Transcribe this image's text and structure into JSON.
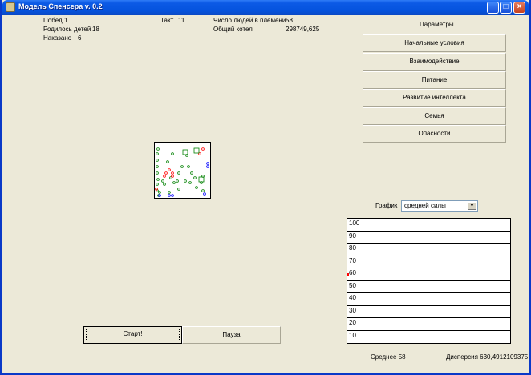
{
  "window": {
    "title": "Модель Спенсера v. 0.2"
  },
  "stats": {
    "wins_label": "Побед",
    "wins": "1",
    "births_label": "Родилось детей",
    "births": "18",
    "punished_label": "Наказано",
    "punished": "6",
    "tick_label": "Такт",
    "tick": "11",
    "people_label": "Число людей в племени",
    "people": "58",
    "pot_label": "Общий котел",
    "pot": "298749,625"
  },
  "params": {
    "title": "Параметры",
    "buttons": [
      "Начальные условия",
      "Взаимодействие",
      "Питание",
      "Развитие интеллекта",
      "Семья",
      "Опасности"
    ]
  },
  "graph": {
    "label": "График",
    "selected": "средней силы",
    "rows": [
      "100",
      "90",
      "80",
      "70",
      "60",
      "50",
      "40",
      "30",
      "20",
      "10"
    ],
    "mean_label": "Среднее",
    "mean": "58",
    "disp_label": "Дисперсия",
    "disp": "630,4912109375"
  },
  "controls": {
    "start": "Старт!",
    "pause": "Пауза"
  },
  "colors": {
    "green": "#008000",
    "red": "#ff0000",
    "blue": "#0000ff",
    "title_bar": "#0553dd"
  },
  "field_agents": {
    "green": [
      [
        4,
        8
      ],
      [
        3,
        14
      ],
      [
        3,
        22
      ],
      [
        3,
        30
      ],
      [
        3,
        38
      ],
      [
        4,
        46
      ],
      [
        3,
        52
      ],
      [
        3,
        60
      ],
      [
        5,
        66
      ],
      [
        22,
        14
      ],
      [
        20,
        44
      ],
      [
        24,
        50
      ],
      [
        30,
        58
      ],
      [
        38,
        48
      ],
      [
        44,
        50
      ],
      [
        46,
        38
      ],
      [
        50,
        44
      ],
      [
        52,
        56
      ],
      [
        58,
        50
      ],
      [
        60,
        60
      ],
      [
        60,
        42
      ],
      [
        42,
        30
      ],
      [
        40,
        16
      ],
      [
        12,
        52
      ],
      [
        16,
        24
      ],
      [
        6,
        62
      ],
      [
        10,
        48
      ],
      [
        18,
        62
      ],
      [
        28,
        48
      ],
      [
        34,
        30
      ],
      [
        30,
        38
      ]
    ],
    "red": [
      [
        14,
        38
      ],
      [
        18,
        34
      ],
      [
        22,
        38
      ],
      [
        22,
        42
      ],
      [
        60,
        8
      ],
      [
        56,
        14
      ],
      [
        2,
        58
      ],
      [
        12,
        42
      ]
    ],
    "blue": [
      [
        66,
        26
      ],
      [
        66,
        30
      ],
      [
        18,
        66
      ],
      [
        22,
        66
      ],
      [
        62,
        64
      ],
      [
        6,
        66
      ]
    ],
    "green_squares": [
      [
        38,
        12
      ],
      [
        52,
        10
      ],
      [
        58,
        46
      ]
    ]
  }
}
